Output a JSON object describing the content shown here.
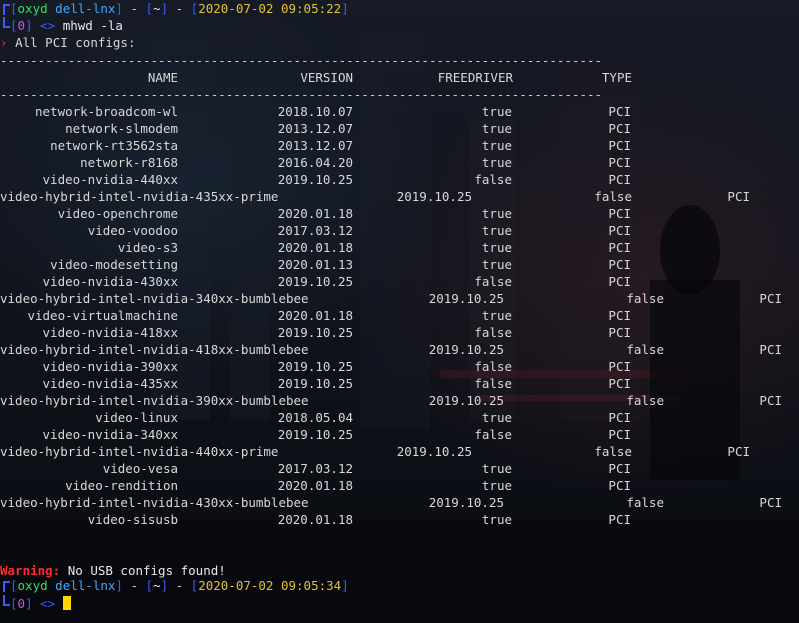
{
  "prompt1": {
    "user": "oxyd",
    "host": "dell-lnx",
    "dir": "~",
    "timestamp": "2020-07-02 09:05:22",
    "status": "0",
    "command": "mhwd -la"
  },
  "header_line": "All PCI configs:",
  "separator": "--------------------------------------------------------------------------------",
  "columns": [
    "NAME",
    "VERSION",
    "FREEDRIVER",
    "TYPE"
  ],
  "rows": [
    {
      "name": "network-broadcom-wl",
      "version": "2018.10.07",
      "free": "true",
      "type": "PCI"
    },
    {
      "name": "network-slmodem",
      "version": "2013.12.07",
      "free": "true",
      "type": "PCI"
    },
    {
      "name": "network-rt3562sta",
      "version": "2013.12.07",
      "free": "true",
      "type": "PCI"
    },
    {
      "name": "network-r8168",
      "version": "2016.04.20",
      "free": "true",
      "type": "PCI"
    },
    {
      "name": "video-nvidia-440xx",
      "version": "2019.10.25",
      "free": "false",
      "type": "PCI"
    },
    {
      "name": "video-hybrid-intel-nvidia-435xx-prime",
      "version": "2019.10.25",
      "free": "false",
      "type": "PCI"
    },
    {
      "name": "video-openchrome",
      "version": "2020.01.18",
      "free": "true",
      "type": "PCI"
    },
    {
      "name": "video-voodoo",
      "version": "2017.03.12",
      "free": "true",
      "type": "PCI"
    },
    {
      "name": "video-s3",
      "version": "2020.01.18",
      "free": "true",
      "type": "PCI"
    },
    {
      "name": "video-modesetting",
      "version": "2020.01.13",
      "free": "true",
      "type": "PCI"
    },
    {
      "name": "video-nvidia-430xx",
      "version": "2019.10.25",
      "free": "false",
      "type": "PCI"
    },
    {
      "name": "video-hybrid-intel-nvidia-340xx-bumblebee",
      "version": "2019.10.25",
      "free": "false",
      "type": "PCI"
    },
    {
      "name": "video-virtualmachine",
      "version": "2020.01.18",
      "free": "true",
      "type": "PCI"
    },
    {
      "name": "video-nvidia-418xx",
      "version": "2019.10.25",
      "free": "false",
      "type": "PCI"
    },
    {
      "name": "video-hybrid-intel-nvidia-418xx-bumblebee",
      "version": "2019.10.25",
      "free": "false",
      "type": "PCI"
    },
    {
      "name": "video-nvidia-390xx",
      "version": "2019.10.25",
      "free": "false",
      "type": "PCI"
    },
    {
      "name": "video-nvidia-435xx",
      "version": "2019.10.25",
      "free": "false",
      "type": "PCI"
    },
    {
      "name": "video-hybrid-intel-nvidia-390xx-bumblebee",
      "version": "2019.10.25",
      "free": "false",
      "type": "PCI"
    },
    {
      "name": "video-linux",
      "version": "2018.05.04",
      "free": "true",
      "type": "PCI"
    },
    {
      "name": "video-nvidia-340xx",
      "version": "2019.10.25",
      "free": "false",
      "type": "PCI"
    },
    {
      "name": "video-hybrid-intel-nvidia-440xx-prime",
      "version": "2019.10.25",
      "free": "false",
      "type": "PCI"
    },
    {
      "name": "video-vesa",
      "version": "2017.03.12",
      "free": "true",
      "type": "PCI"
    },
    {
      "name": "video-rendition",
      "version": "2020.01.18",
      "free": "true",
      "type": "PCI"
    },
    {
      "name": "video-hybrid-intel-nvidia-430xx-bumblebee",
      "version": "2019.10.25",
      "free": "false",
      "type": "PCI"
    },
    {
      "name": "video-sisusb",
      "version": "2020.01.18",
      "free": "true",
      "type": "PCI"
    }
  ],
  "warning": {
    "label": "Warning:",
    "message": "No USB configs found!"
  },
  "prompt2": {
    "user": "oxyd",
    "host": "dell-lnx",
    "dir": "~",
    "timestamp": "2020-07-02 09:05:34",
    "status": "0"
  }
}
